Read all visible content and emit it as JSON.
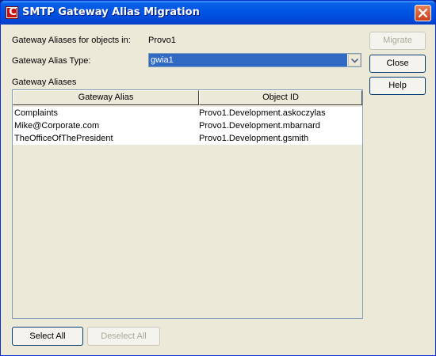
{
  "window": {
    "title": "SMTP Gateway Alias Migration",
    "app_icon_letter": "C"
  },
  "form": {
    "objects_in_label": "Gateway Aliases for objects in:",
    "objects_in_value": "Provo1",
    "alias_type_label": "Gateway Alias Type:",
    "alias_type_value": "gwia1",
    "aliases_group_label": "Gateway Aliases"
  },
  "table": {
    "columns": [
      "Gateway Alias",
      "Object ID"
    ],
    "rows": [
      {
        "alias": "Complaints",
        "object_id": "Provo1.Development.askoczylas"
      },
      {
        "alias": "Mike@Corporate.com",
        "object_id": "Provo1.Development.mbarnard"
      },
      {
        "alias": "TheOfficeOfThePresident",
        "object_id": "Provo1.Development.gsmith"
      }
    ]
  },
  "buttons": {
    "migrate": "Migrate",
    "close": "Close",
    "help": "Help",
    "select_all": "Select All",
    "deselect_all": "Deselect All"
  },
  "colors": {
    "title_bar": "#0054e3",
    "selection": "#316ac5",
    "dialog_bg": "#ece9d8",
    "close_button": "#d45a2e"
  },
  "icons": {
    "title_icon": "consoleone-icon",
    "window_close": "close-icon",
    "dropdown": "chevron-down-icon"
  }
}
